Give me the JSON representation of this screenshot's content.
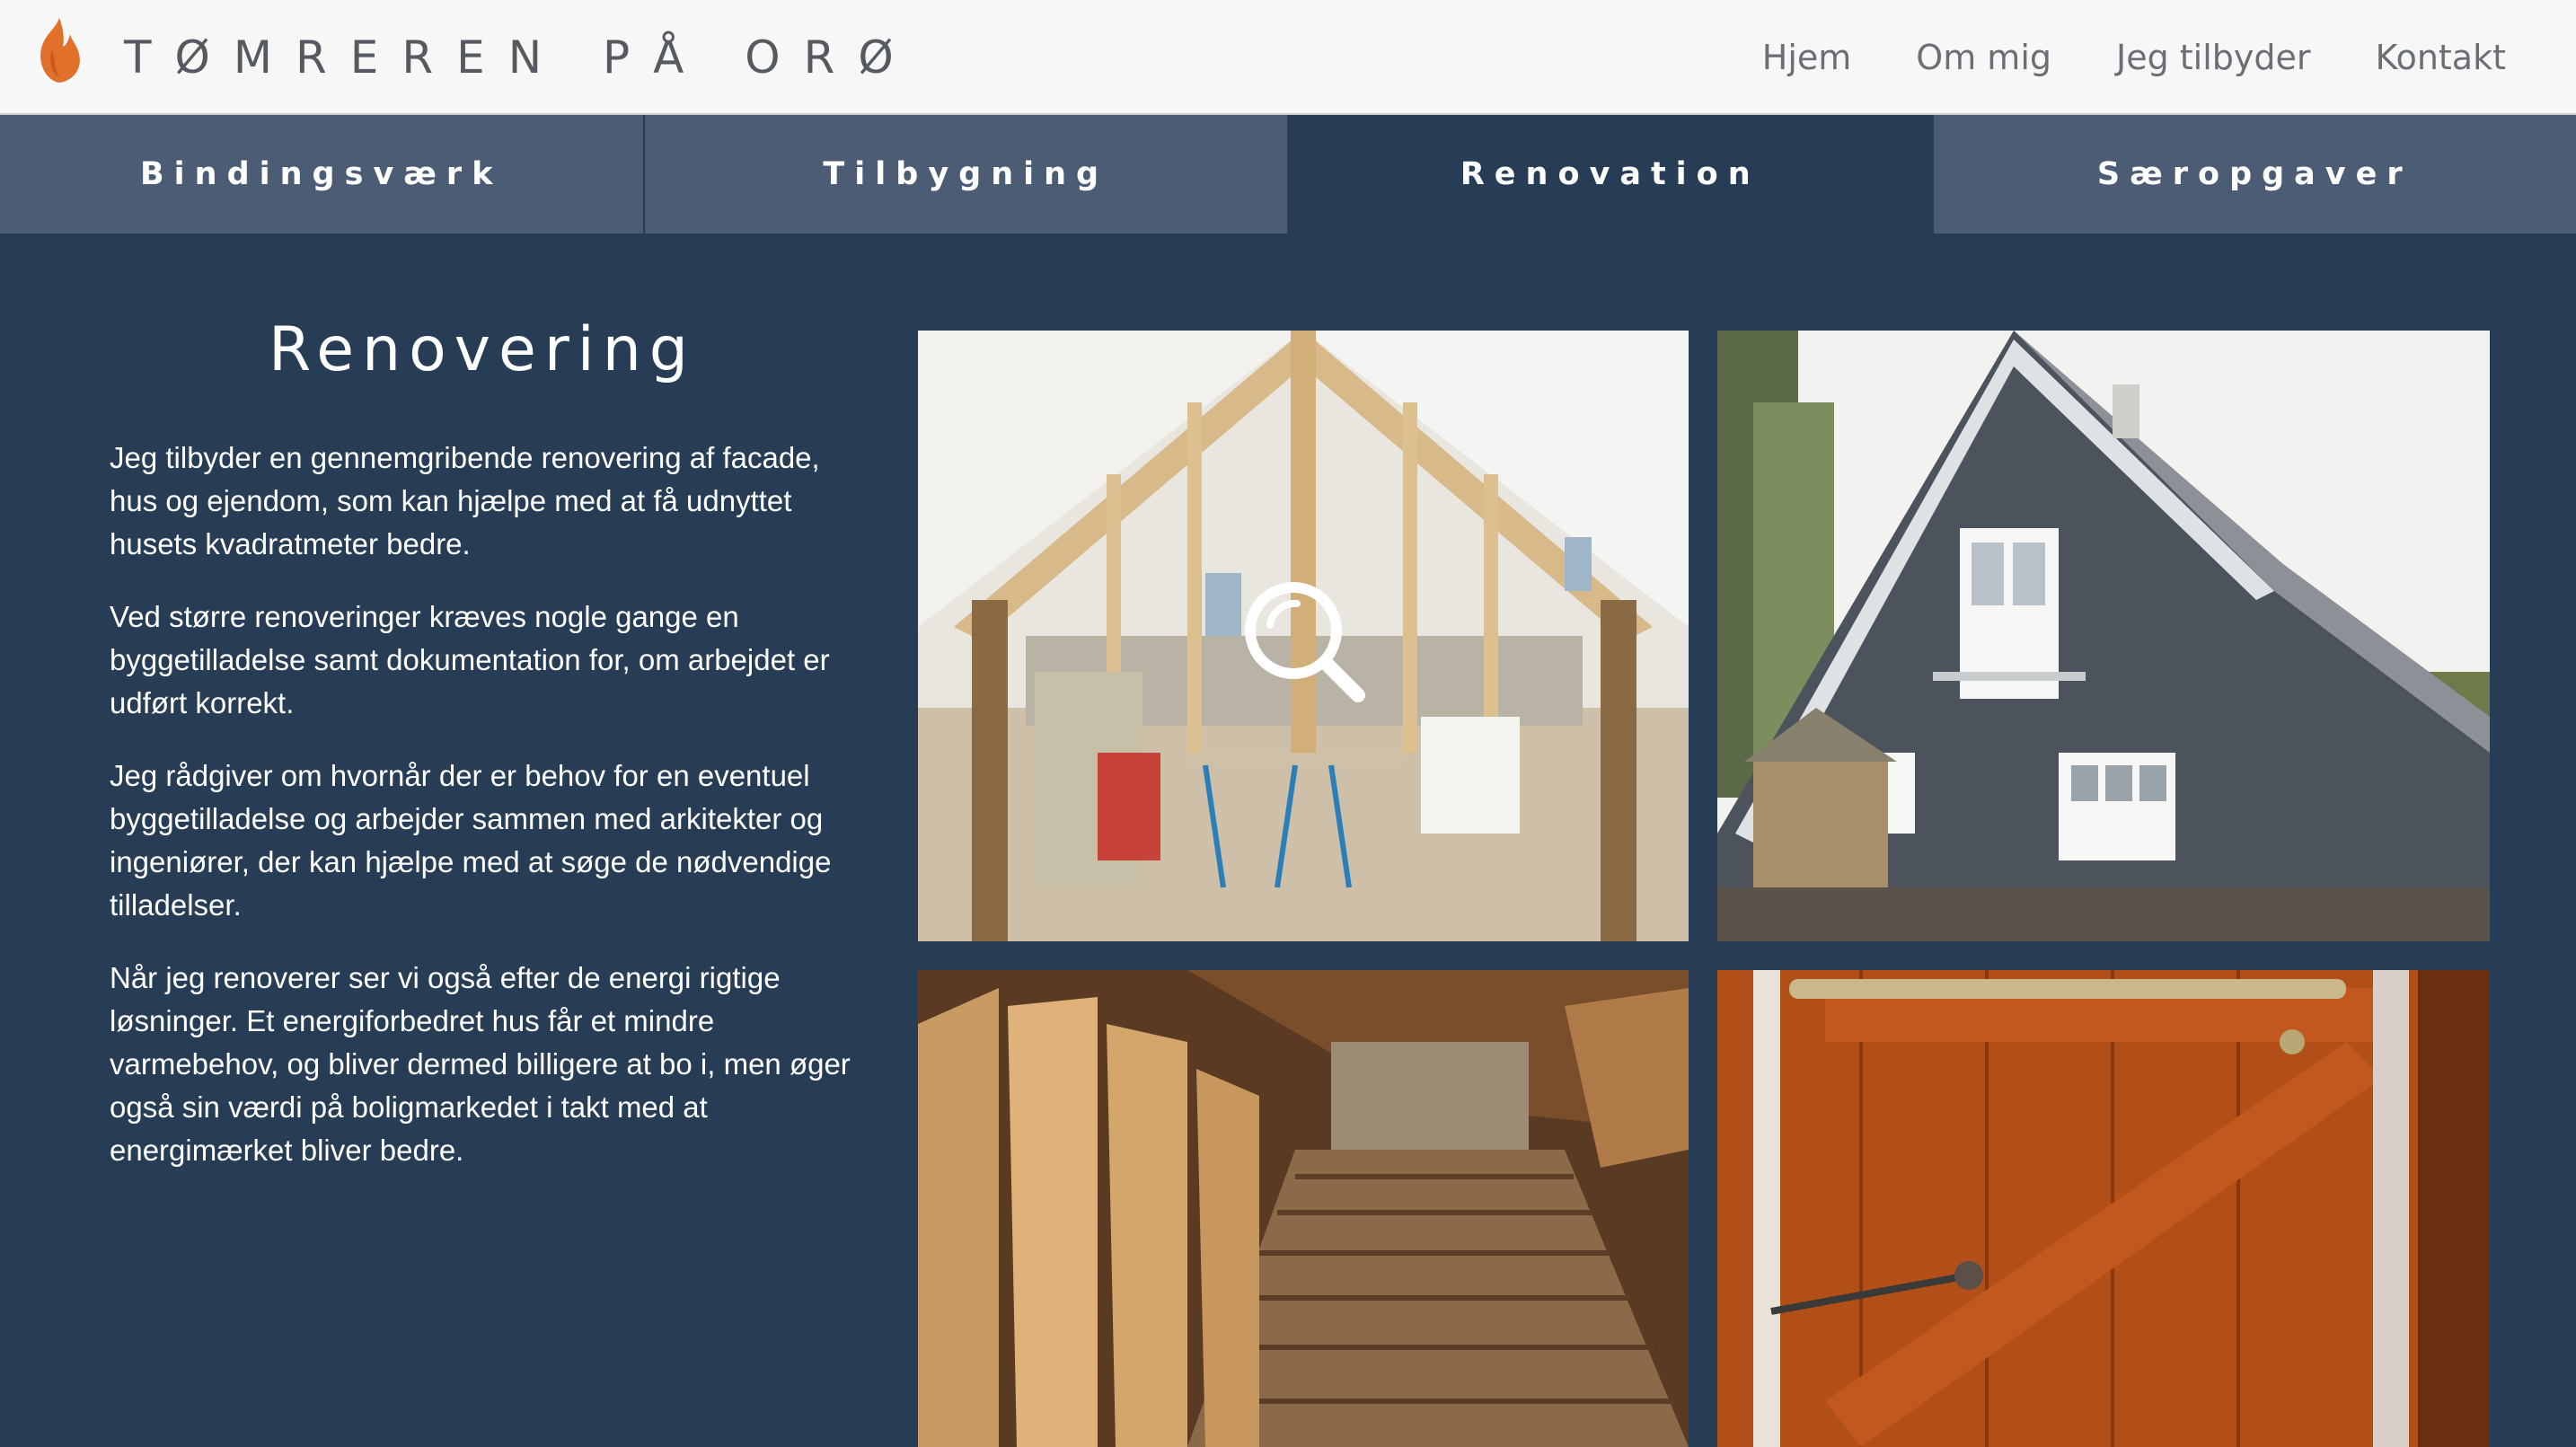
{
  "brand": {
    "name": "TØMREREN PÅ ORØ",
    "logo_icon": "flame-logo-icon"
  },
  "nav": {
    "items": [
      "Hjem",
      "Om mig",
      "Jeg tilbyder",
      "Kontakt"
    ]
  },
  "tabs": {
    "items": [
      "Bindingsværk",
      "Tilbygning",
      "Renovation",
      "Særopgaver"
    ],
    "active": "Renovation"
  },
  "content": {
    "title": "Renovering",
    "paragraphs": [
      "Jeg tilbyder en gennemgribende renovering af facade, hus og ejendom, som kan hjælpe med at få udnyttet husets kvadratmeter bedre.",
      "Ved større renoveringer kræves nogle gange en byggetilladelse samt dokumentation for, om arbejdet er udført korrekt.",
      "Jeg rådgiver om hvornår der er behov for en eventuel byggetilladelse og arbejder sammen med arkitekter og ingeniører, der kan hjælpe med at søge de nødvendige tilladelser.",
      "Når jeg renoverer ser vi også efter de energi rigtige løsninger. Et energiforbedret hus får et mindre varmebehov, og bliver dermed billigere at bo i, men øger også sin værdi på boligmarkedet i takt med at energimærket bliver bedre."
    ]
  },
  "gallery": {
    "images": [
      "attic-framing-photo",
      "grey-house-photo",
      "attic-floor-photo",
      "wooden-door-photo"
    ],
    "hover_icon": "magnifier-icon"
  },
  "colors": {
    "header_bg": "#f7f7f7",
    "tab_bg": "#4b5c74",
    "tab_active_bg": "#263d55",
    "main_bg": "#263d55",
    "logo_orange": "#e0702a"
  }
}
